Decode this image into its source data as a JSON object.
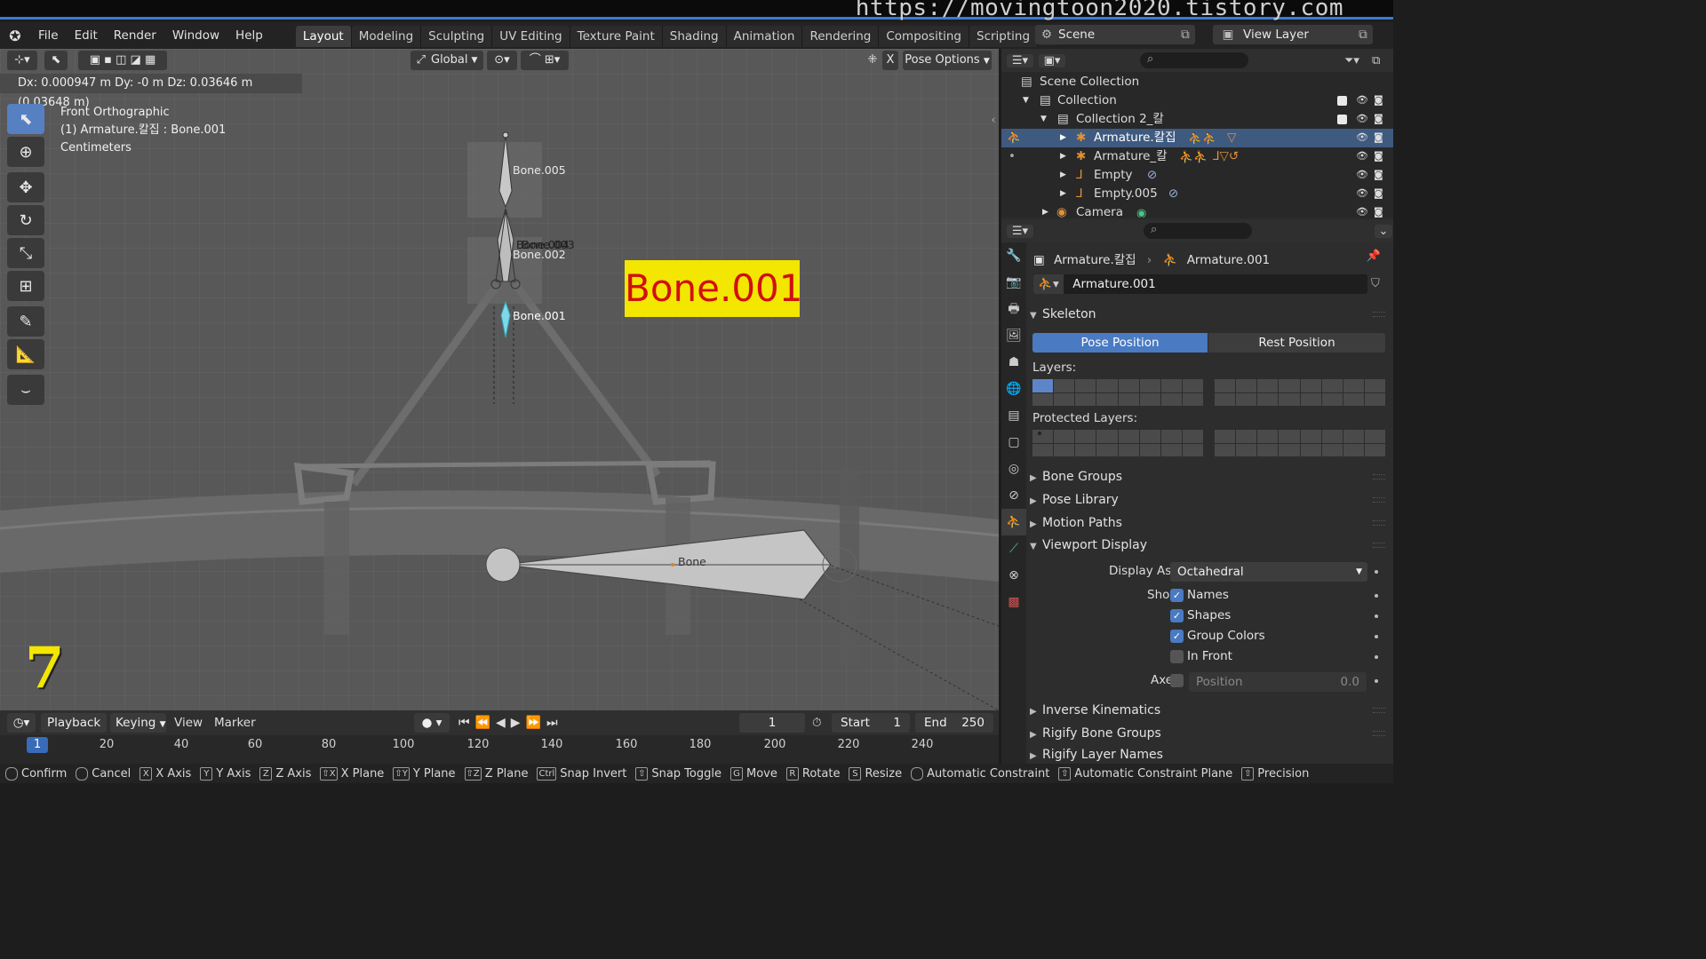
{
  "watermark": "https://movingtoon2020.tistory.com",
  "menu": {
    "items": [
      "File",
      "Edit",
      "Render",
      "Window",
      "Help"
    ]
  },
  "workspaces": {
    "tabs": [
      "Layout",
      "Modeling",
      "Sculpting",
      "UV Editing",
      "Texture Paint",
      "Shading",
      "Animation",
      "Rendering",
      "Compositing",
      "Scripting"
    ],
    "active": "Layout",
    "add": "+"
  },
  "scene": {
    "name": "Scene",
    "view_layer": "View Layer"
  },
  "viewport": {
    "transform_orientation": "Global",
    "pose_options": "Pose Options",
    "x_toggle": "X",
    "operator_text": "Dx: 0.000947 m   Dy: -0 m  Dz: 0.03646 m (0.03648 m)",
    "view_name": "Front Orthographic",
    "object_info": "(1) Armature.칼집 : Bone.001",
    "units": "Centimeters",
    "highlight_label": "Bone.001",
    "step_number": "7",
    "bones": {
      "bone005": "Bone.005",
      "bone004": "Bone.004",
      "bone003": "Bone.003",
      "bone002": "Bone.002",
      "bone001": "Bone.001",
      "bone": "Bone"
    }
  },
  "timeline": {
    "playback": "Playback",
    "keying": "Keying",
    "view": "View",
    "marker": "Marker",
    "current_frame": "1",
    "start_label": "Start",
    "start": "1",
    "end_label": "End",
    "end": "250",
    "ruler": [
      "1",
      "20",
      "40",
      "60",
      "80",
      "100",
      "120",
      "140",
      "160",
      "180",
      "200",
      "220",
      "240"
    ]
  },
  "statusbar": [
    {
      "key": "",
      "label": "Confirm"
    },
    {
      "key": "",
      "label": "Cancel"
    },
    {
      "key": "X",
      "label": "X Axis"
    },
    {
      "key": "Y",
      "label": "Y Axis"
    },
    {
      "key": "Z",
      "label": "Z Axis"
    },
    {
      "key": "⇧X",
      "label": "X Plane"
    },
    {
      "key": "⇧Y",
      "label": "Y Plane"
    },
    {
      "key": "⇧Z",
      "label": "Z Plane"
    },
    {
      "key": "Ctrl",
      "label": "Snap Invert"
    },
    {
      "key": "⇧",
      "label": "Snap Toggle"
    },
    {
      "key": "G",
      "label": "Move"
    },
    {
      "key": "R",
      "label": "Rotate"
    },
    {
      "key": "S",
      "label": "Resize"
    },
    {
      "key": "",
      "label": "Automatic Constraint"
    },
    {
      "key": "⇧",
      "label": "Automatic Constraint Plane"
    },
    {
      "key": "⇧",
      "label": "Precision"
    }
  ],
  "outliner": {
    "scene_collection": "Scene Collection",
    "rows": [
      {
        "label": "Collection"
      },
      {
        "label": "Collection 2_칼"
      },
      {
        "label": "Armature.칼집"
      },
      {
        "label": "Armature_칼"
      },
      {
        "label": "Empty"
      },
      {
        "label": "Empty.005"
      },
      {
        "label": "Camera"
      }
    ]
  },
  "properties": {
    "breadcrumb_object": "Armature.칼집",
    "breadcrumb_data": "Armature.001",
    "data_name": "Armature.001",
    "skeleton": "Skeleton",
    "pose_position": "Pose Position",
    "rest_position": "Rest Position",
    "layers": "Layers:",
    "protected_layers": "Protected Layers:",
    "bone_groups": "Bone Groups",
    "pose_library": "Pose Library",
    "motion_paths": "Motion Paths",
    "viewport_display": "Viewport Display",
    "display_as_label": "Display As",
    "display_as": "Octahedral",
    "show_label": "Show",
    "names": "Names",
    "shapes": "Shapes",
    "group_colors": "Group Colors",
    "in_front": "In Front",
    "axes_label": "Axes",
    "position": "Position",
    "position_value": "0.0",
    "inverse_kinematics": "Inverse Kinematics",
    "rigify_bone_groups": "Rigify Bone Groups",
    "rigify_layer_names": "Rigify Layer Names"
  }
}
